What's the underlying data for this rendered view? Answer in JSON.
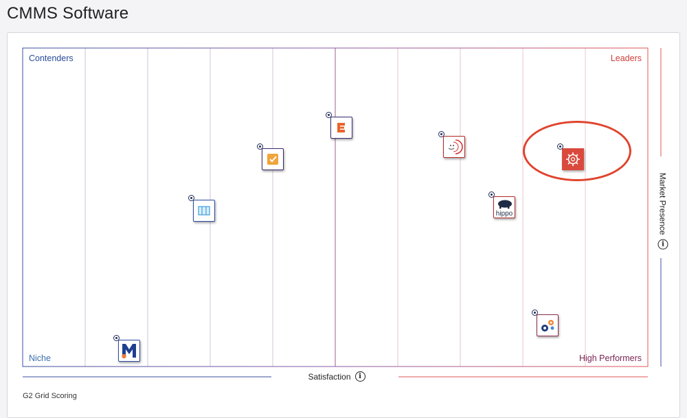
{
  "page": {
    "title": "CMMS Software"
  },
  "chart_data": {
    "type": "scatter",
    "title": "CMMS Software",
    "xlabel": "Satisfaction",
    "ylabel": "Market Presence",
    "xlim": [
      0,
      10
    ],
    "ylim": [
      0,
      10
    ],
    "grid": true,
    "quadrants": {
      "top_left": "Contenders",
      "top_right": "Leaders",
      "bottom_left": "Niche",
      "bottom_right": "High Performers"
    },
    "points": [
      {
        "id": "product-e",
        "x": 5.1,
        "y": 7.5,
        "logo": "orange-e-logo",
        "border": "#3b2a6e"
      },
      {
        "id": "product-check",
        "x": 4.0,
        "y": 6.5,
        "logo": "orange-check-logo",
        "border": "#3b2a6e"
      },
      {
        "id": "product-map",
        "x": 2.9,
        "y": 4.9,
        "logo": "blue-map-logo",
        "border": "#2c4ba0"
      },
      {
        "id": "product-face",
        "x": 6.9,
        "y": 6.9,
        "logo": "red-face-logo",
        "border": "#b32828"
      },
      {
        "id": "product-gear-red",
        "x": 8.8,
        "y": 6.5,
        "logo": "red-gear-logo",
        "border": "#b32828",
        "highlighted": true
      },
      {
        "id": "product-hippo",
        "x": 7.7,
        "y": 5.0,
        "logo": "hippo-logo",
        "border": "#b32828",
        "text": "hippo"
      },
      {
        "id": "product-gears",
        "x": 8.4,
        "y": 1.3,
        "logo": "gears-logo",
        "border": "#8a2a4a"
      },
      {
        "id": "product-m",
        "x": 1.7,
        "y": 0.5,
        "logo": "blue-m-logo",
        "border": "#2c4ba0"
      }
    ]
  },
  "axis": {
    "x_label": "Satisfaction",
    "y_label": "Market Presence"
  },
  "footer": {
    "note": "G2 Grid Scoring"
  },
  "colors": {
    "contenders": "#2a4a9c",
    "leaders": "#d23b3b",
    "niche": "#3a6fb0",
    "high_performers": "#7b2454",
    "highlight": "#e0442d"
  }
}
